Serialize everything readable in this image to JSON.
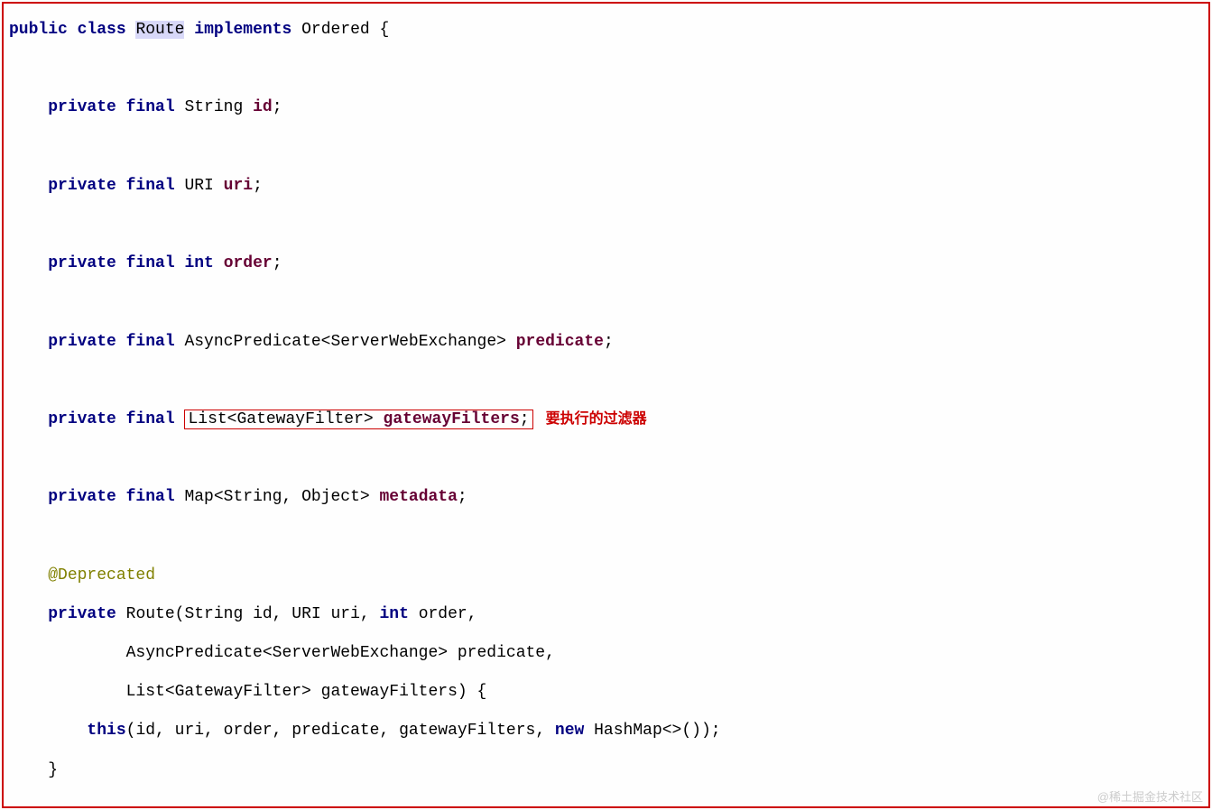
{
  "code": {
    "line1_public": "public",
    "line1_class": "class",
    "line1_route": "Route",
    "line1_implements": "implements",
    "line1_rest": " Ordered {",
    "field1_mod": "private final",
    "field1_type": " String ",
    "field1_name": "id",
    "field2_mod": "private final",
    "field2_type": " URI ",
    "field2_name": "uri",
    "field3_mod": "private final",
    "field3_int": " int",
    "field3_name": "order",
    "field4_mod": "private final",
    "field4_type": " AsyncPredicate<ServerWebExchange> ",
    "field4_name": "predicate",
    "field5_mod": "private final",
    "field5_boxed": "List<GatewayFilter> ",
    "field5_name": "gatewayFilters",
    "field5_semicolon": ";",
    "field5_comment": "要执行的过滤器",
    "field6_mod": "private final",
    "field6_type": " Map<String, Object> ",
    "field6_name": "metadata",
    "annotation": "@Deprecated",
    "ctor_private": "private",
    "ctor_sig1": " Route(String id, URI uri, ",
    "ctor_int": "int",
    "ctor_sig1b": " order,",
    "ctor_sig2": "            AsyncPredicate<ServerWebExchange> predicate,",
    "ctor_sig3": "            List<GatewayFilter> gatewayFilters) {",
    "ctor_this": "this",
    "ctor_body": "(id, uri, order, predicate, gatewayFilters, ",
    "ctor_new": "new",
    "ctor_body2": " HashMap<>());",
    "close_brace": "    }",
    "semicolon": ";"
  },
  "watermark": "@稀土掘金技术社区"
}
